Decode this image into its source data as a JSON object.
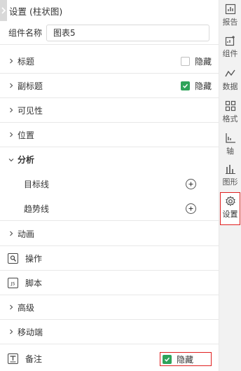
{
  "header": {
    "title": "设置 (柱状图)"
  },
  "name_row": {
    "label": "组件名称",
    "value": "图表5"
  },
  "sections": {
    "title": {
      "label": "标题",
      "hide_label": "隐藏",
      "hide_checked": false
    },
    "subtitle": {
      "label": "副标题",
      "hide_label": "隐藏",
      "hide_checked": true
    },
    "visibility": {
      "label": "可见性"
    },
    "position": {
      "label": "位置"
    },
    "analysis": {
      "label": "分析",
      "target_line": "目标线",
      "trend_line": "趋势线"
    },
    "animation": {
      "label": "动画"
    },
    "operation": {
      "label": "操作"
    },
    "script": {
      "label": "脚本",
      "icon_text": "JS"
    },
    "advanced": {
      "label": "高级"
    },
    "mobile": {
      "label": "移动端"
    },
    "remark": {
      "label": "备注",
      "hide_label": "隐藏",
      "hide_checked": true
    }
  },
  "sidebar": {
    "report": "报告",
    "component": "组件",
    "data": "数据",
    "format": "格式",
    "axis": "轴",
    "shape": "图形",
    "settings": "设置"
  },
  "colors": {
    "accent_green": "#2fa35a",
    "highlight_red": "#e02020",
    "sidebar_bg": "#f2f2f2"
  }
}
